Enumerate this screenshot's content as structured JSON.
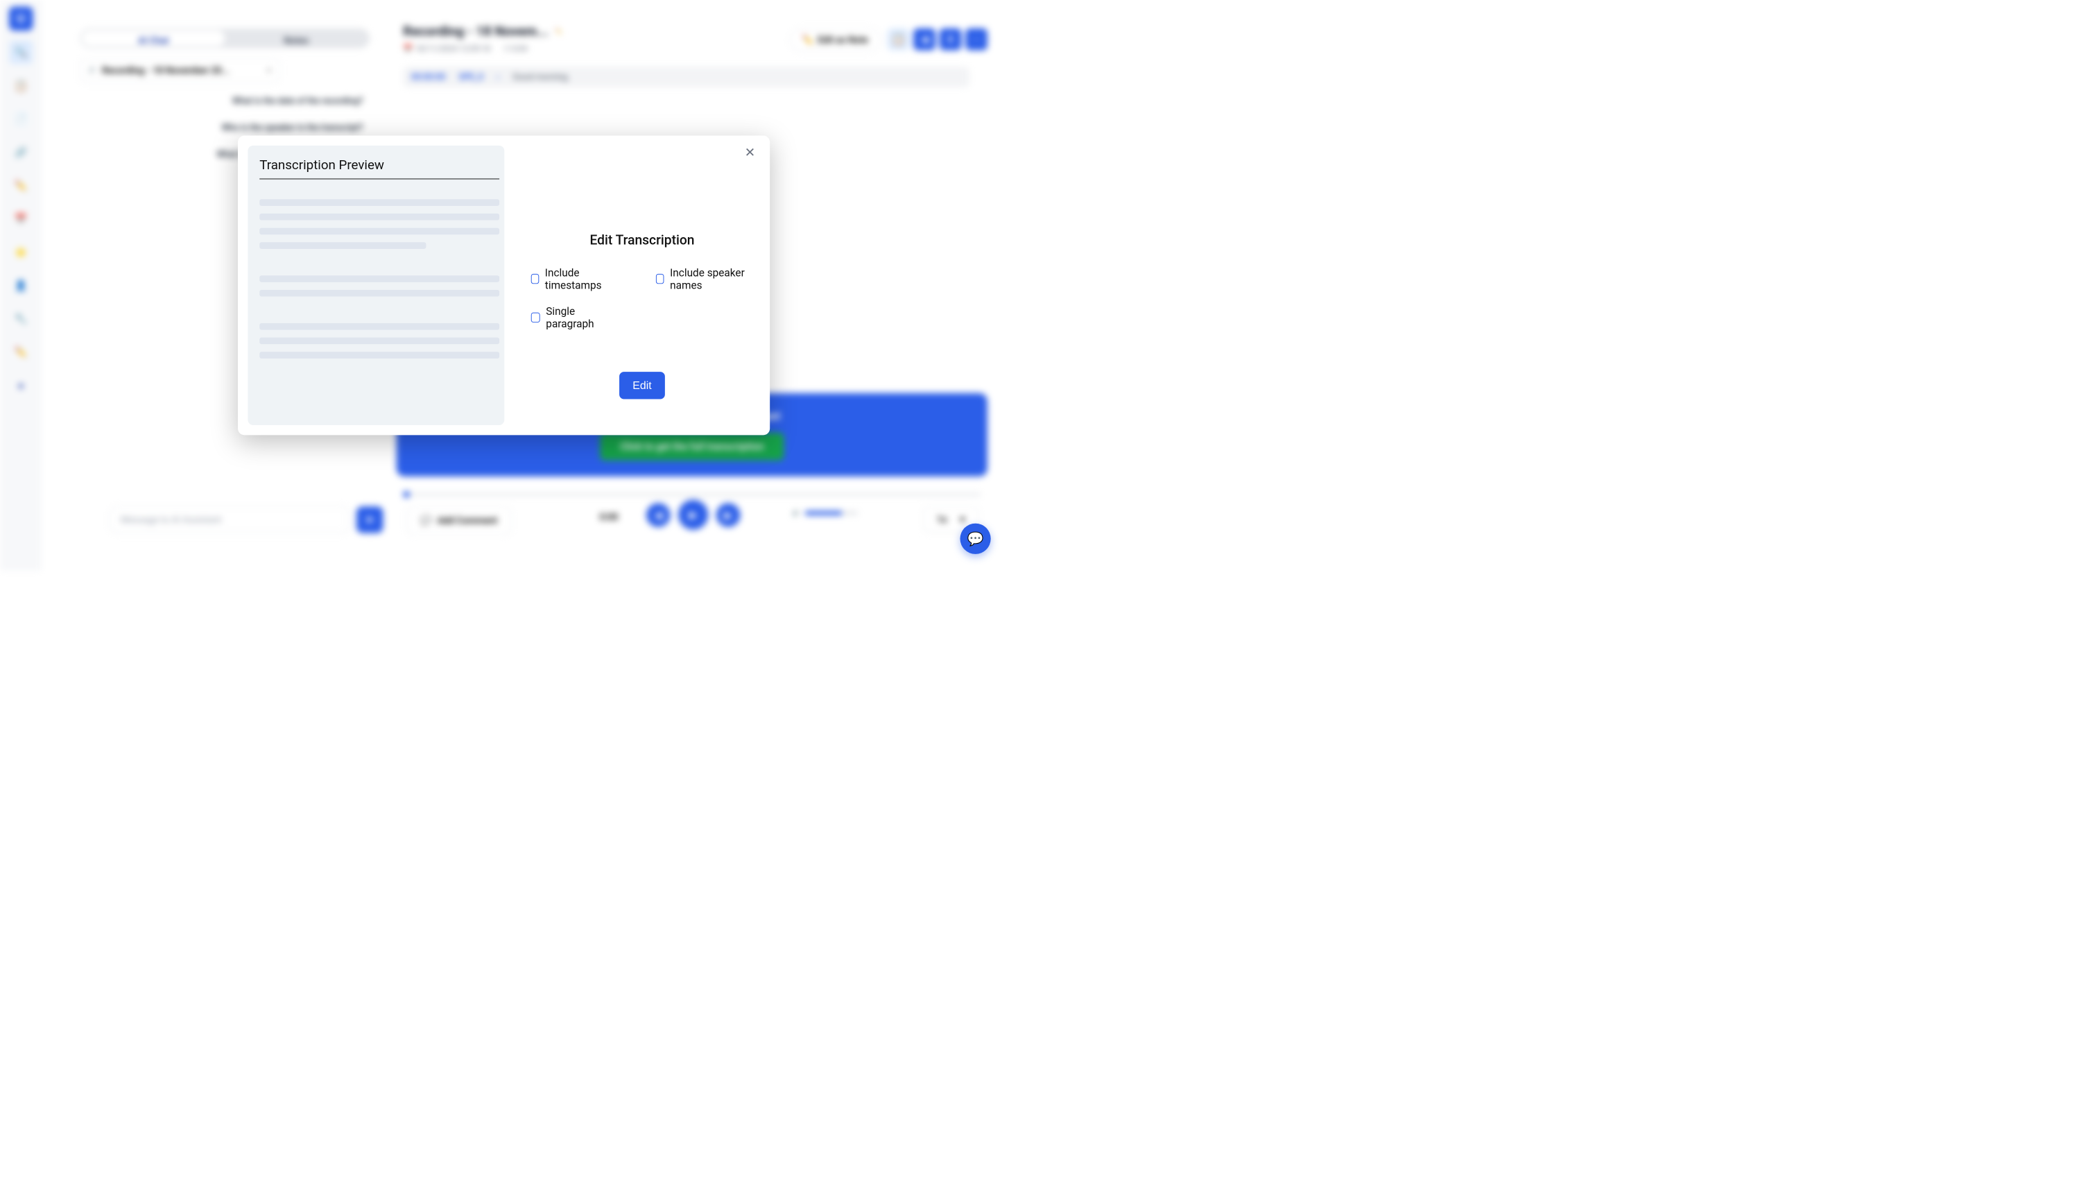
{
  "sidebar": {
    "logo": "U"
  },
  "leftPanel": {
    "tab_ai": "AI Chat",
    "tab_notes": "Notes",
    "breadcrumb": "Recording - 18 November 20...",
    "chat1": "What is the date of the recording?",
    "chat2": "Who is the speaker in the transcript?",
    "chat3": "What is the topic of the conversation?"
  },
  "header": {
    "title": "Recording - 18 Novem...",
    "date": "18/11/2024  12:09:18",
    "duration": "0:04",
    "edit_note": "Edit as Note"
  },
  "transcript": {
    "timestamp": "00:00:00",
    "speaker": "SPE_0",
    "text": "Good morning."
  },
  "banner": {
    "text": "Transcription available in a snippet",
    "cta": "Click to get the full transcription"
  },
  "player": {
    "time": "0:00",
    "speed": "1x"
  },
  "input": {
    "placeholder": "Message to AI Assistant",
    "comment": "Add Comment"
  },
  "modal": {
    "title": "Transcription Preview",
    "edit_title": "Edit Transcription",
    "opt1": "Include timestamps",
    "opt2": "Include speaker names",
    "opt3": "Single paragraph",
    "btn": "Edit"
  }
}
